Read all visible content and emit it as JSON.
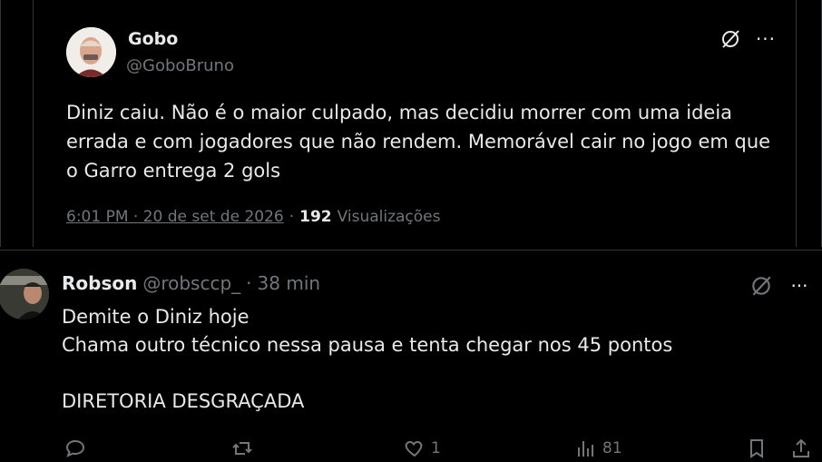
{
  "main_tweet": {
    "author_name": "Gobo",
    "author_handle": "@GoboBruno",
    "text": "Diniz caiu. Não é o maior culpado, mas decidiu morrer com uma ideia\nerrada e com jogadores que não rendem. Memorável cair no jogo em que\no Garro entrega 2 gols",
    "time": "6:01 PM · 20 de set de 2026",
    "separator": "·",
    "views_count": "192",
    "views_label": "Visualizações",
    "more_label": "···"
  },
  "reply": {
    "author_name": "Robson",
    "author_handle": "@robsccp_",
    "separator": "·",
    "age": "38 min",
    "text": "Demite o Diniz hoje\nChama outro técnico nessa pausa e tenta chegar nos 45 pontos\n\nDIRETORIA DESGRAÇADA",
    "more_label": "···",
    "actions": {
      "reply_count": "",
      "retweet_count": "",
      "like_count": "1",
      "views_count": "81"
    }
  },
  "colors": {
    "background": "#000000",
    "text": "#e7e9ea",
    "secondary": "#71767b",
    "border": "#2f3336"
  }
}
